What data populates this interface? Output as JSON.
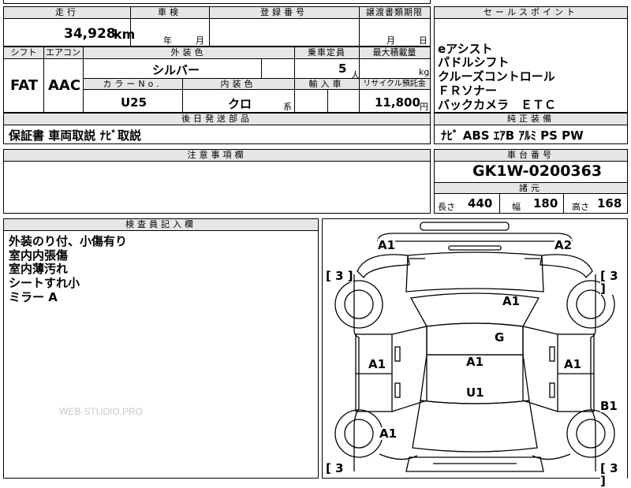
{
  "top": {
    "mileage_label": "走行",
    "mileage_value": "34,928",
    "mileage_unit": "km",
    "inspection_label": "車検",
    "year_unit": "年",
    "month_unit": "月",
    "registration_label": "登録番号",
    "transfer_label": "譲渡書類期限",
    "transfer_month_unit": "月",
    "transfer_day_unit": "日"
  },
  "specs": {
    "shift_label": "シフト",
    "shift_value": "FAT",
    "aircon_label": "エアコン",
    "aircon_value": "AAC",
    "exterior_label": "外装色",
    "exterior_value": "シルバー",
    "capacity_label": "乗車定員",
    "capacity_value": "5",
    "capacity_unit": "人",
    "maxload_label": "最大積載量",
    "maxload_unit": "kg",
    "color_no_label": "カラーNo.",
    "color_no_value": "U25",
    "interior_label": "内装色",
    "interior_value": "クロ",
    "interior_unit": "系",
    "import_label": "輸入車",
    "recycle_label": "リサイクル預託金",
    "recycle_value": "11,800",
    "recycle_unit": "円"
  },
  "later_parts": {
    "label": "後日発送部品",
    "value": "保証書 車両取説 ﾅﾋﾞ取説"
  },
  "notes": {
    "label": "注意事項欄"
  },
  "inspector": {
    "label": "検査員記入欄",
    "lines": [
      "外装のり付、小傷有り",
      "室内内張傷",
      "室内薄汚れ",
      "シートすれ小",
      "ミラー A"
    ]
  },
  "sales_points": {
    "label": "セールスポイント",
    "items": [
      "eアシスト",
      "パドルシフト",
      "クルーズコントロール",
      "ＦＲソナー",
      "バックカメラ　ＥＴＣ"
    ]
  },
  "equipment": {
    "label": "純正装備",
    "value": "ﾅﾋﾞ ABS ｴｱB ｱﾙﾐ PS PW"
  },
  "chassis": {
    "label": "車台番号",
    "value": "GK1W-0200363"
  },
  "dimensions": {
    "label": "諸元",
    "length_label": "長さ",
    "length_value": "440",
    "width_label": "幅",
    "width_value": "180",
    "height_label": "高さ",
    "height_value": "168"
  },
  "diagram": {
    "marks": {
      "front_left": "A1",
      "front_right": "A2",
      "hood": "A1",
      "windshield": "G",
      "roof": "A1",
      "rear_window": "U1",
      "left_door": "A1",
      "right_door": "A1",
      "rear_right": "B1",
      "rear_left": "A1"
    },
    "tires": {
      "tl": "[ 3 ]",
      "tr": "[ 3 ]",
      "bl": "[ 3",
      "br": "[ 3 ]"
    }
  },
  "watermark": "WEB-STUDIO.PRO"
}
